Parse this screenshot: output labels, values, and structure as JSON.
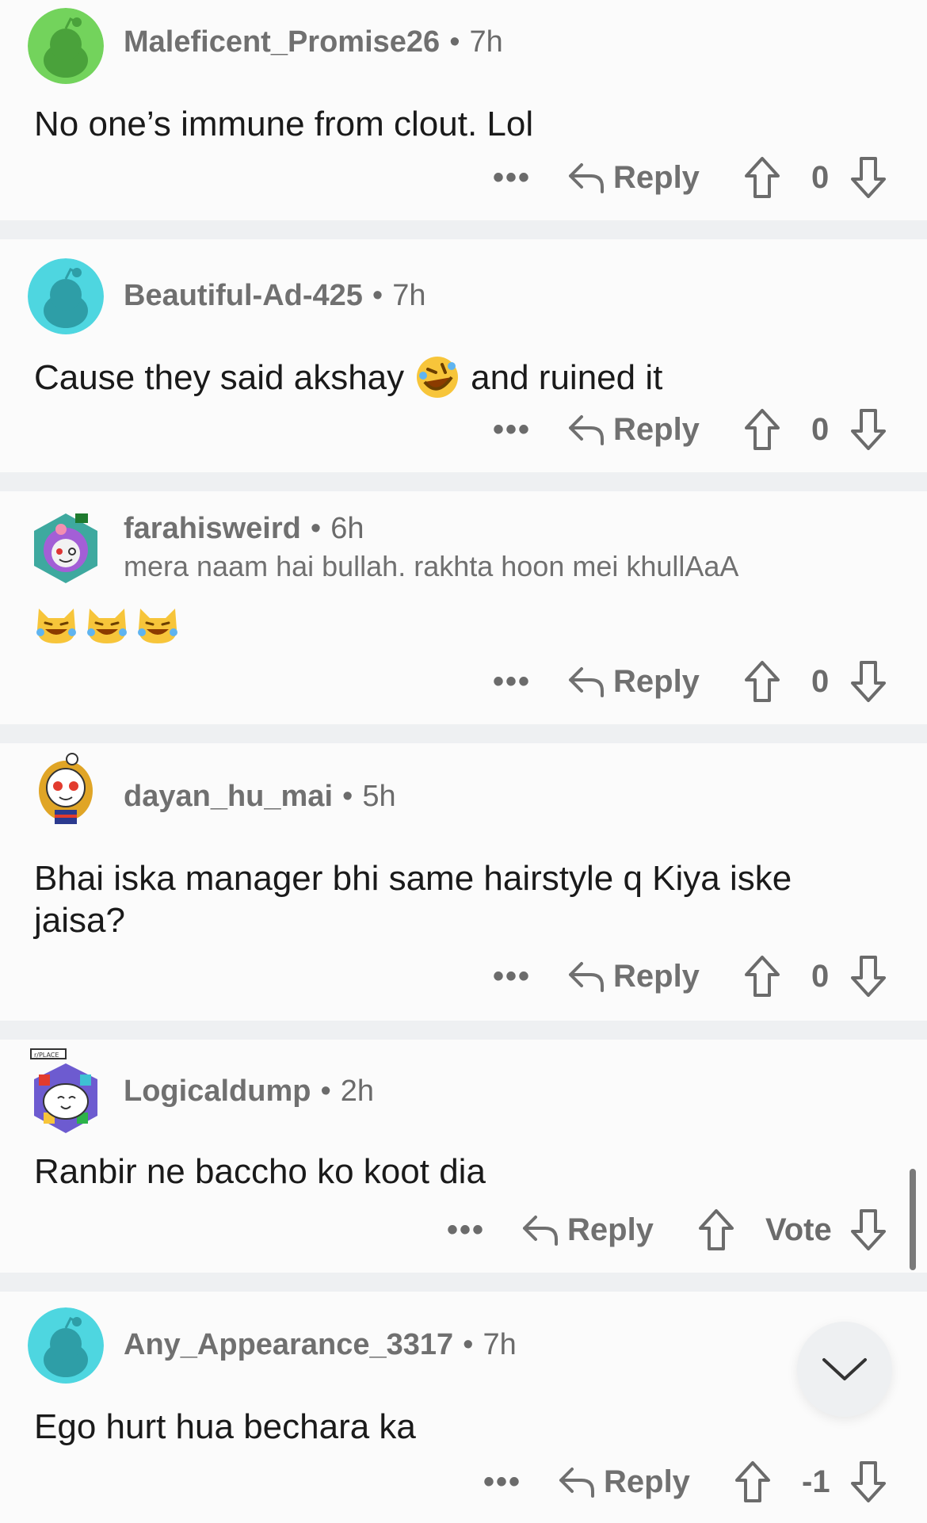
{
  "comments": [
    {
      "username": "Maleficent_Promise26",
      "time": "7h",
      "text": "No one’s immune from clout. Lol",
      "flair": "",
      "reply_label": "Reply",
      "score": "0",
      "more": "•••",
      "avatar_color": "#73d35c"
    },
    {
      "username": "Beautiful-Ad-425",
      "time": "7h",
      "text_a": "Cause they said akshay",
      "text_b": "and ruined it",
      "reply_label": "Reply",
      "score": "0",
      "more": "•••",
      "avatar_color": "#4ed6e0"
    },
    {
      "username": "farahisweird",
      "time": "6h",
      "flair": "mera naam hai bullah. rakhta hoon mei khullAaA",
      "reply_label": "Reply",
      "score": "0",
      "more": "•••"
    },
    {
      "username": "dayan_hu_mai",
      "time": "5h",
      "text": "Bhai iska manager bhi same hairstyle q Kiya iske jaisa?",
      "reply_label": "Reply",
      "score": "0",
      "more": "•••"
    },
    {
      "username": "Logicaldump",
      "time": "2h",
      "text": "Ranbir ne baccho ko koot dia",
      "reply_label": "Reply",
      "score": "Vote",
      "more": "•••",
      "badge": "r/PLACE"
    },
    {
      "username": "Any_Appearance_3317",
      "time": "7h",
      "text": "Ego hurt hua bechara ka",
      "reply_label": "Reply",
      "score": "-1",
      "more": "•••",
      "avatar_color": "#4ed6e0"
    }
  ],
  "separator": "•",
  "icons": {
    "reply": "reply-arrow-icon",
    "upvote": "upvote-arrow-icon",
    "downvote": "downvote-arrow-icon",
    "more": "more-options-icon",
    "scroll_down": "chevron-down-icon"
  },
  "colors": {
    "background": "#fbfbfb",
    "separator": "#eef0f2",
    "meta": "#6b6b6b",
    "text": "#1a1a1a"
  }
}
